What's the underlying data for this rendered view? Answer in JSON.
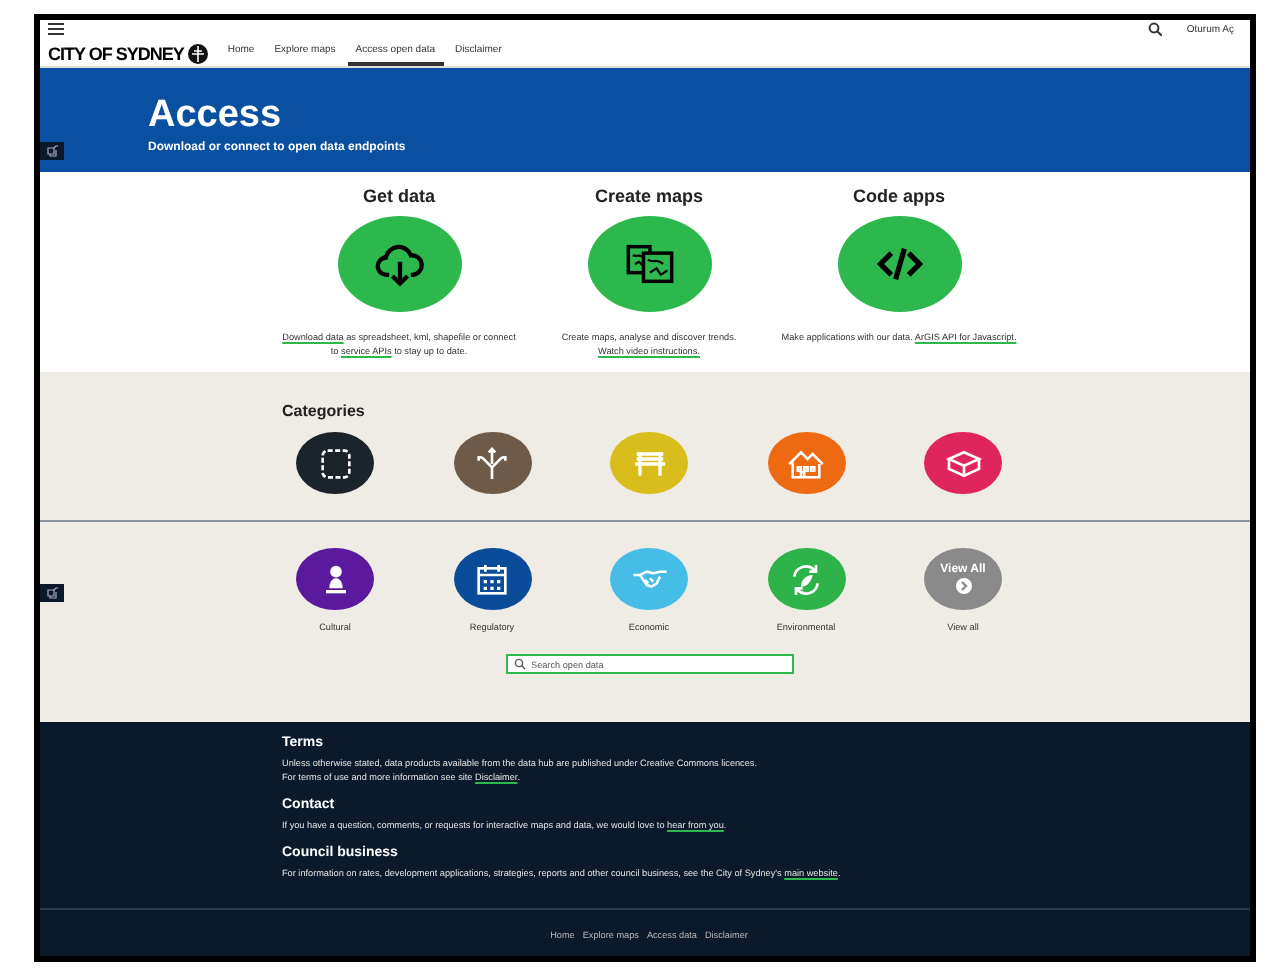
{
  "header": {
    "logo": "CITY OF SYDNEY",
    "nav": [
      {
        "label": "Home",
        "selected": false
      },
      {
        "label": "Explore maps",
        "selected": false
      },
      {
        "label": "Access open data",
        "selected": true
      },
      {
        "label": "Disclaimer",
        "selected": false
      }
    ],
    "sign_in": "Oturum Aç"
  },
  "banner": {
    "title": "Access",
    "subtitle": "Download or connect to open data endpoints"
  },
  "features": [
    {
      "title": "Get data",
      "kind": "download",
      "description": [
        {
          "kind": "link",
          "text": "Download data"
        },
        {
          "kind": "text",
          "text": " as spreadsheet, kml, shapefile or connect to "
        },
        {
          "kind": "link",
          "text": "service APIs"
        },
        {
          "kind": "text",
          "text": " to stay up to date."
        }
      ]
    },
    {
      "title": "Create maps",
      "kind": "maps",
      "description": [
        {
          "kind": "text",
          "text": "Create maps, analyse and discover trends. "
        },
        {
          "kind": "link",
          "text": "Watch video instructions."
        }
      ]
    },
    {
      "title": "Code apps",
      "kind": "code",
      "description": [
        {
          "kind": "text",
          "text": "Make applications with our data. "
        },
        {
          "kind": "link",
          "text": "ArGIS API for Javascript."
        }
      ]
    }
  ],
  "categories": {
    "title": "Categories",
    "rows": [
      [
        {
          "kind": "frame",
          "color": "#1b232b"
        },
        {
          "kind": "split",
          "color": "#6e5a48"
        },
        {
          "kind": "bench",
          "color": "#d9bd1c"
        },
        {
          "kind": "houses",
          "color": "#ee6a12"
        },
        {
          "kind": "blocks",
          "color": "#e0245e"
        }
      ],
      [
        {
          "kind": "bust",
          "color": "#5b1a9e",
          "label": "Cultural"
        },
        {
          "kind": "calendar",
          "color": "#0a4c9a",
          "label": "Regulatory"
        },
        {
          "kind": "handshake",
          "color": "#45bde6",
          "label": "Economic"
        },
        {
          "kind": "recycle",
          "color": "#2eb24a",
          "label": "Environmental"
        },
        {
          "kind": "view_all",
          "color": "#8a8a8a",
          "text": "View All",
          "label": "View all"
        }
      ]
    ]
  },
  "search": {
    "placeholder": "Search open data"
  },
  "footer": {
    "sections": [
      {
        "title": "Terms",
        "paragraphs": [
          [
            {
              "kind": "text",
              "text": "Unless otherwise stated, data products available from the data hub are published under Creative Commons licences."
            }
          ],
          [
            {
              "kind": "text",
              "text": "For terms of use and more information see site "
            },
            {
              "kind": "link",
              "text": "Disclaimer"
            },
            {
              "kind": "text",
              "text": "."
            }
          ]
        ]
      },
      {
        "title": "Contact",
        "paragraphs": [
          [
            {
              "kind": "text",
              "text": "If you have a question, comments, or requests for interactive maps and data, we would love to "
            },
            {
              "kind": "link",
              "text": "hear from you"
            },
            {
              "kind": "text",
              "text": "."
            }
          ]
        ]
      },
      {
        "title": "Council business",
        "paragraphs": [
          [
            {
              "kind": "text",
              "text": "For information on rates, development applications, strategies, reports and other council business, see the City of Sydney's "
            },
            {
              "kind": "link",
              "text": "main website"
            },
            {
              "kind": "text",
              "text": "."
            }
          ]
        ]
      }
    ],
    "links": [
      "Home",
      "Explore maps",
      "Access data",
      "Disclaimer"
    ]
  }
}
